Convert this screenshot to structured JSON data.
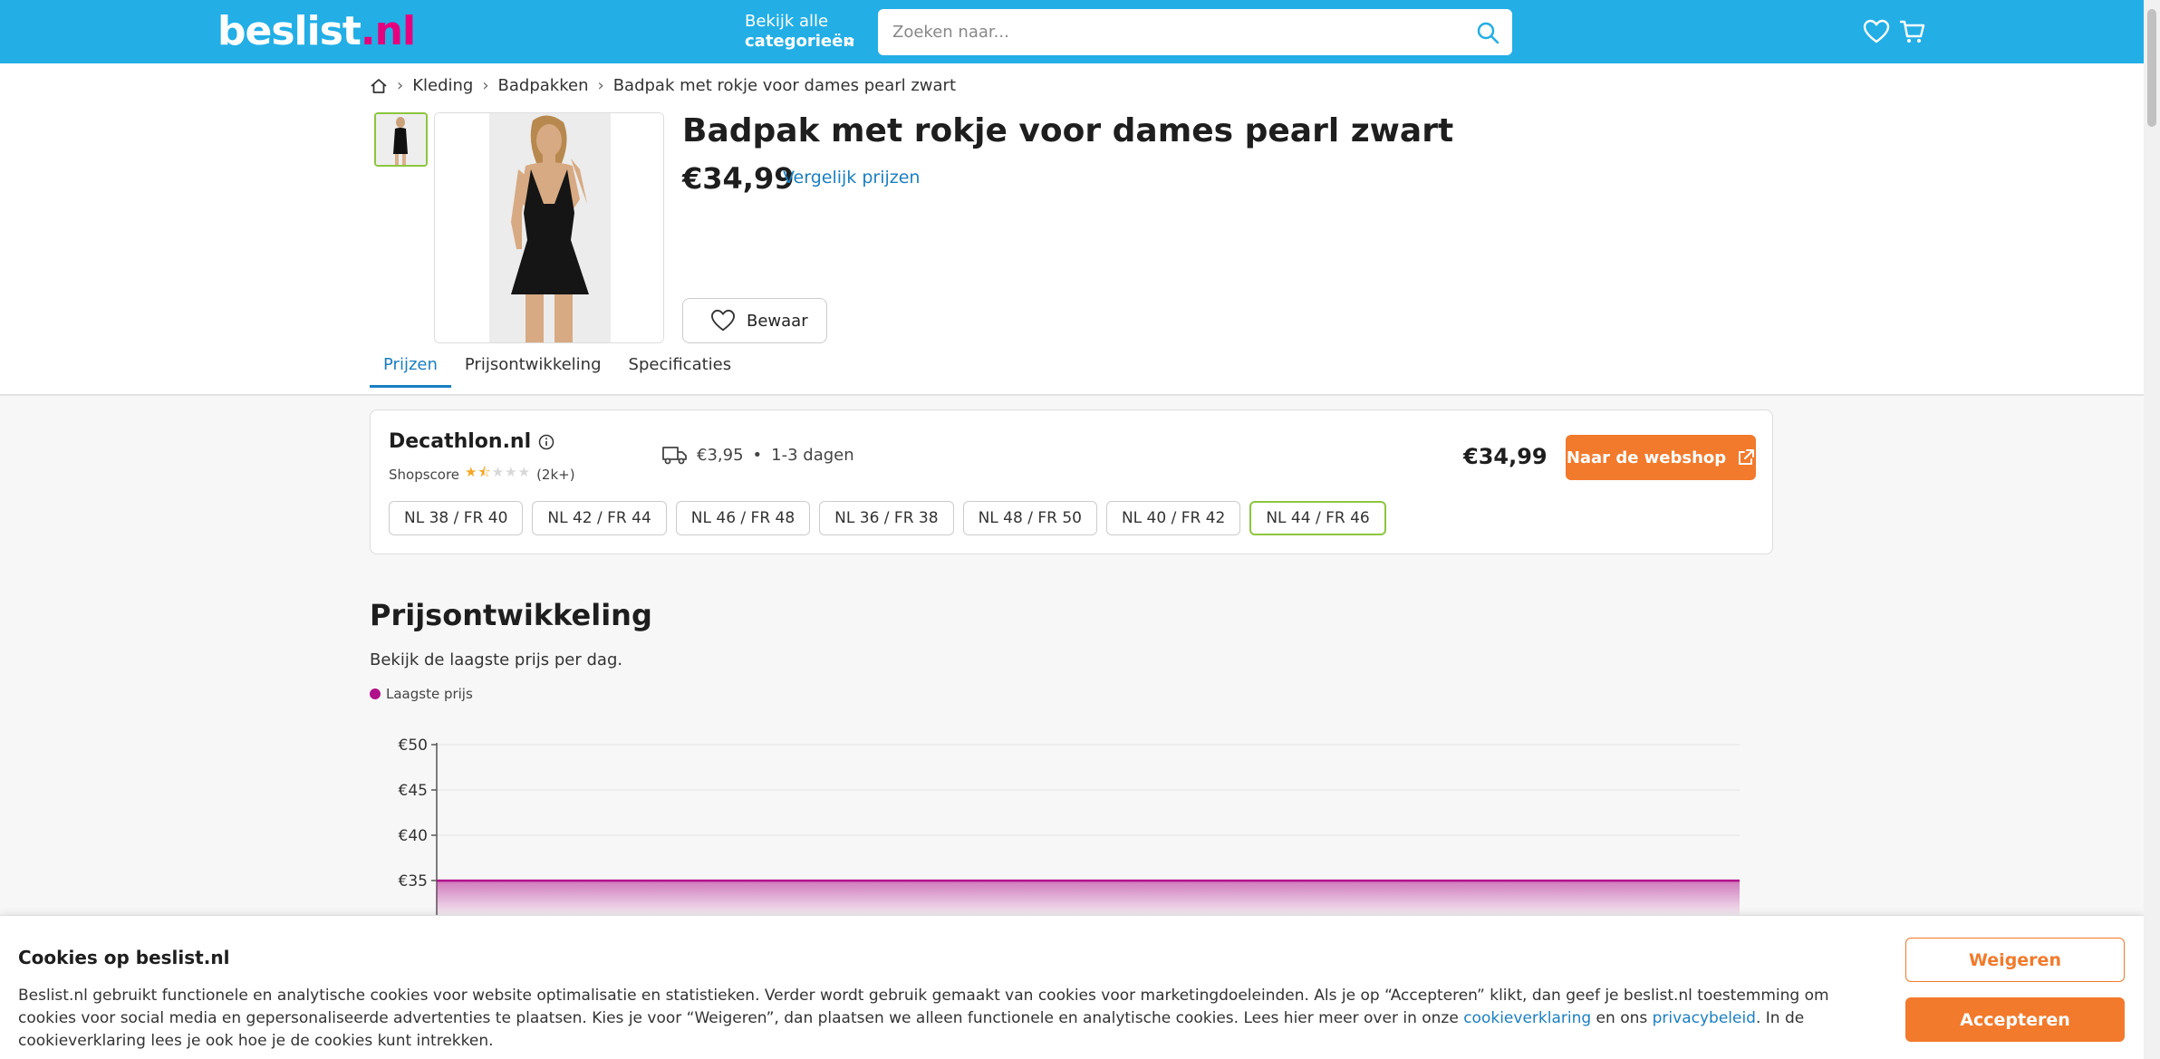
{
  "header": {
    "logo_main": "beslist",
    "logo_tld": ".nl",
    "categories_line1": "Bekijk alle",
    "categories_line2": "categorieën",
    "search_placeholder": "Zoeken naar...",
    "brand_color": "#23aee5"
  },
  "breadcrumb": [
    "Kleding",
    "Badpakken",
    "Badpak met rokje voor dames pearl zwart"
  ],
  "product": {
    "title": "Badpak met rokje voor dames pearl zwart",
    "price": "€34,99",
    "compare_link": "Vergelijk prijzen",
    "save_label": "Bewaar"
  },
  "tabs": [
    "Prijzen",
    "Prijsontwikkeling",
    "Specificaties"
  ],
  "offer": {
    "shop": "Decathlon.nl",
    "shopscore_label": "Shopscore",
    "rating": 1.5,
    "rating_max": 5,
    "review_count": "(2k+)",
    "shipping": "€3,95",
    "bullet": "•",
    "delivery_time": "1-3 dagen",
    "price": "€34,99",
    "button_label": "Naar de webshop",
    "sizes": [
      "NL 38 / FR 40",
      "NL 42 / FR 44",
      "NL 46 / FR 48",
      "NL 36 / FR 38",
      "NL 48 / FR 50",
      "NL 40 / FR 42",
      "NL 44 / FR 46"
    ],
    "selected_size": "NL 44 / FR 46",
    "accent_color": "#f27a2c"
  },
  "price_history": {
    "title": "Prijsontwikkeling",
    "subtitle": "Bekijk de laagste prijs per dag.",
    "legend": "Laagste prijs"
  },
  "chart_data": {
    "type": "area",
    "series": [
      {
        "name": "Laagste prijs",
        "values": [
          34.99,
          34.99
        ]
      }
    ],
    "y_ticks": [
      "€50",
      "€45",
      "€40",
      "€35"
    ],
    "y_tick_values": [
      50,
      45,
      40,
      35
    ],
    "ylim": [
      30,
      50
    ],
    "color": "#b0108a",
    "grid": true
  },
  "cookie": {
    "title": "Cookies op beslist.nl",
    "text_before": "Beslist.nl gebruikt functionele en analytische cookies voor website optimalisatie en statistieken. Verder wordt gebruik gemaakt van cookies voor marketingdoeleinden. Als je op “Accepteren” klikt, dan geef je beslist.nl toestemming om cookies voor social media en gepersonaliseerde advertenties te plaatsen. Kies je voor “Weigeren”, dan plaatsen we alleen functionele en analytische cookies. Lees hier meer over in onze ",
    "link1": "cookieverklaring",
    "text_mid": " en ons ",
    "link2": "privacybeleid",
    "text_after": ". In de cookieverklaring lees je ook hoe je de cookies kunt intrekken.",
    "reject_label": "Weigeren",
    "accept_label": "Accepteren"
  }
}
